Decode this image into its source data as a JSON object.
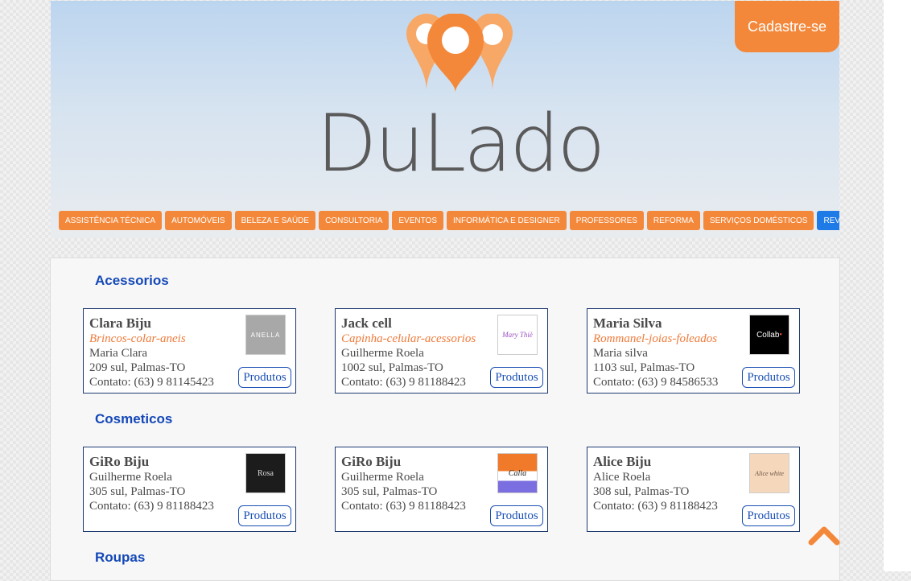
{
  "header": {
    "register_label": "Cadastre-se",
    "logo_text": "DuLado",
    "brand_color": "#f4883a",
    "nav": [
      {
        "label": "ASSISTÊNCIA TÉCNICA",
        "color": "#f4883a"
      },
      {
        "label": "AUTOMÓVEIS",
        "color": "#f4883a"
      },
      {
        "label": "BELEZA E SAÚDE",
        "color": "#f4883a"
      },
      {
        "label": "CONSULTORIA",
        "color": "#f4883a"
      },
      {
        "label": "EVENTOS",
        "color": "#f4883a"
      },
      {
        "label": "INFORMÁTICA E DESIGNER",
        "color": "#f4883a"
      },
      {
        "label": "PROFESSORES",
        "color": "#f4883a"
      },
      {
        "label": "REFORMA",
        "color": "#f4883a"
      },
      {
        "label": "SERVIÇOS DOMÉSTICOS",
        "color": "#f4883a"
      },
      {
        "label": "REVENDEDORES",
        "color": "#1e7ae6"
      }
    ]
  },
  "sections": [
    {
      "title": "Acessorios",
      "cards": [
        {
          "name": "Clara Biju",
          "subtitle": "Brincos-colar-aneis",
          "owner": "Maria Clara",
          "address": "209 sul, Palmas-TO",
          "contact": "Contato: (63) 9 81145423",
          "logo_text": "ANELLA",
          "button": "Produtos"
        },
        {
          "name": "Jack cell",
          "subtitle": "Capinha-celular-acessorios",
          "owner": "Guilherme Roela",
          "address": "1002 sul, Palmas-TO",
          "contact": "Contato: (63) 9 81188423",
          "logo_text": "Mary Thiè",
          "button": "Produtos"
        },
        {
          "name": "Maria Silva",
          "subtitle": "Rommanel-joias-foleados",
          "owner": "Maria silva",
          "address": "1103 sul, Palmas-TO",
          "contact": "Contato: (63) 9 84586533",
          "logo_text": "Collab",
          "button": "Produtos"
        }
      ]
    },
    {
      "title": "Cosmeticos",
      "cards": [
        {
          "name": "GiRo Biju",
          "owner": "Guilherme Roela",
          "address": "305 sul, Palmas-TO",
          "contact": "Contato: (63) 9 81188423",
          "logo_text": "Rosa",
          "button": "Produtos"
        },
        {
          "name": "GiRo Biju",
          "owner": "Guilherme Roela",
          "address": "305 sul, Palmas-TO",
          "contact": "Contato: (63) 9 81188423",
          "logo_text": "Calla",
          "button": "Produtos"
        },
        {
          "name": "Alice Biju",
          "owner": "Alice Roela",
          "address": "308 sul, Palmas-TO",
          "contact": "Contato: (63) 9 81188423",
          "logo_text": "Alice white",
          "button": "Produtos"
        }
      ]
    },
    {
      "title": "Roupas",
      "cards": []
    }
  ],
  "icons": {
    "scroll_top": "chevron-up-icon",
    "pins": "map-pin-icon"
  }
}
